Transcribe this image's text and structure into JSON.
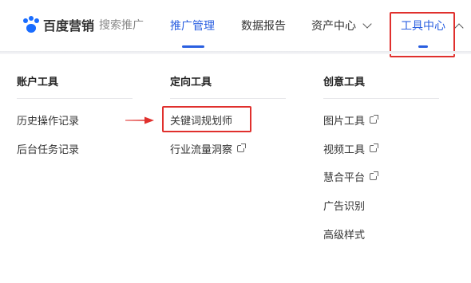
{
  "logo": {
    "brand": "百度营销",
    "sub": "搜索推广"
  },
  "nav": {
    "items": [
      {
        "label": "推广管理"
      },
      {
        "label": "数据报告"
      },
      {
        "label": "资产中心"
      },
      {
        "label": "工具中心"
      }
    ]
  },
  "menu": {
    "columns": [
      {
        "title": "账户工具",
        "items": [
          "历史操作记录",
          "后台任务记录"
        ]
      },
      {
        "title": "定向工具",
        "items": [
          "关键词规划师",
          "行业流量洞察"
        ]
      },
      {
        "title": "创意工具",
        "items": [
          "图片工具",
          "视频工具",
          "慧合平台",
          "广告识别",
          "高级样式"
        ]
      }
    ]
  },
  "colors": {
    "accent": "#2a5fe0",
    "highlight": "#e0302d",
    "logo_blue": "#1a6dff"
  },
  "icons": {
    "external": "external-link-icon",
    "dropdown": "chevron-down-icon",
    "collapse": "chevron-up-icon"
  }
}
